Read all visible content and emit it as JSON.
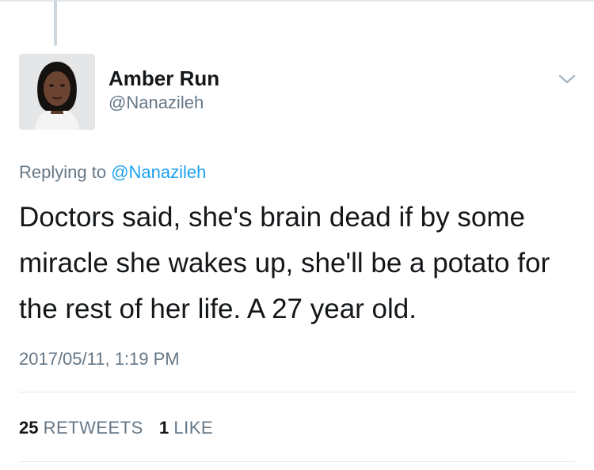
{
  "tweet": {
    "author": {
      "name": "Amber Run",
      "handle": "@Nanazileh"
    },
    "replying_prefix": "Replying to",
    "replying_to": "@Nanazileh",
    "text": "Doctors said, she's brain dead if by some miracle she wakes up, she'll be a potato for the rest of her life. A 27 year old.",
    "timestamp": "2017/05/11, 1:19 PM",
    "stats": {
      "retweets_count": "25",
      "retweets_label": "RETWEETS",
      "likes_count": "1",
      "likes_label": "LIKE"
    }
  },
  "icons": {
    "menu": "chevron-down-icon"
  },
  "colors": {
    "text_primary": "#14171a",
    "text_secondary": "#657786",
    "link": "#1da1f2",
    "divider": "#e1e8ed"
  }
}
